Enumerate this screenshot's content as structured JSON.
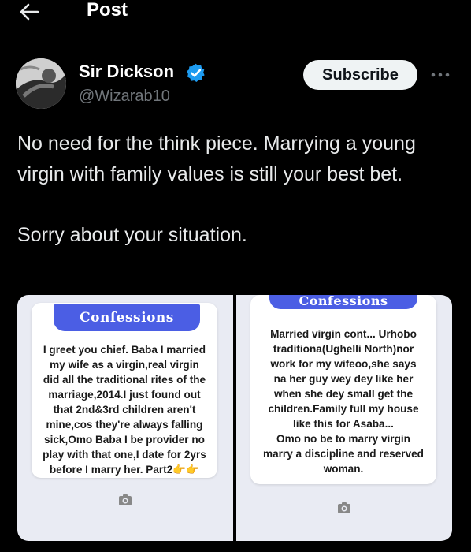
{
  "header": {
    "title": "Post",
    "back_icon": "arrow-left-icon"
  },
  "author": {
    "display_name": "Sir Dickson",
    "handle": "@Wizarab10",
    "verified_icon": "verified-badge-icon",
    "verified_color": "#1d9bf0"
  },
  "actions": {
    "subscribe_label": "Subscribe",
    "more_icon": "more-horizontal-icon"
  },
  "tweet": {
    "lines": [
      "No need for the think piece. Marrying a young virgin with family values is still your best bet.",
      "Sorry about your situation."
    ]
  },
  "media": {
    "left": {
      "banner": "Confessions",
      "lines": [
        "I greet you chief. Baba I married",
        "my wife as a virgin,real virgin",
        "did all the traditional rites of the",
        "marriage,2014.I just found out",
        "that 2nd&3rd children aren't",
        "mine,cos they're always falling",
        "sick,Omo Baba I be provider no",
        "play with that one,I date for 2yrs",
        "before I marry her. Part2👉👉"
      ]
    },
    "right": {
      "banner": "Confessions",
      "lines": [
        "Married virgin cont... Urhobo",
        "traditiona(Ughelli North)nor",
        "work for my wifeoo,she says",
        "na her guy wey dey like her",
        "when she dey small get the",
        "children.Family full my house",
        "like this for Asaba...",
        "Omo no be to marry virgin",
        "marry a discipline and reserved",
        "woman."
      ]
    },
    "camera_icon": "camera-icon",
    "banner_color": "#4b5ee4"
  }
}
